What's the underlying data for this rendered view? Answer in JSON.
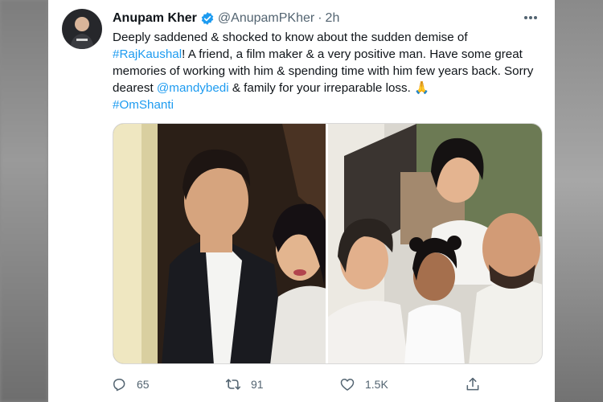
{
  "tweet": {
    "author_name": "Anupam Kher",
    "handle": "@AnupamPKher",
    "separator": "·",
    "time": "2h",
    "text_parts": {
      "p1": "Deeply saddened & shocked to know about the sudden demise of ",
      "tag1": "#RajKaushal",
      "p2": "! A friend, a film maker & a very positive man. Have some great memories of working with him & spending time with him few years back. Sorry dearest ",
      "mention": "@mandybedi",
      "p3": " & family for your irreparable loss. ",
      "emoji": "🙏",
      "tag2": "#OmShanti"
    },
    "stats": {
      "replies": "65",
      "retweets": "91",
      "likes": "1.5K"
    }
  },
  "icons": {
    "verified": "verified-badge-icon",
    "more": "more-options-icon",
    "reply": "reply-icon",
    "retweet": "retweet-icon",
    "like": "heart-icon",
    "share": "share-icon"
  },
  "colors": {
    "link": "#1d9bf0",
    "text": "#0f1419",
    "secondary": "#536471",
    "verified": "#1d9bf0"
  }
}
